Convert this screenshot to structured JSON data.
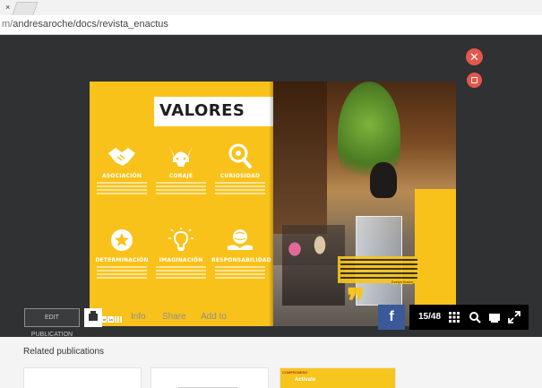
{
  "browser": {
    "tab_close": "×",
    "url_prefix": "m/",
    "url_path": "andresaroche/docs/revista_enactus"
  },
  "publication": {
    "left_page": {
      "title": "VALORES",
      "values": [
        {
          "label": "ASOCIACIÓN",
          "icon": "handshake-icon"
        },
        {
          "label": "CORAJE",
          "icon": "viking-helmet-icon"
        },
        {
          "label": "CURIOSIDAD",
          "icon": "magnifier-icon"
        },
        {
          "label": "DETERMINACIÓN",
          "icon": "star-badge-icon"
        },
        {
          "label": "IMAGINACIÓN",
          "icon": "lightbulb-icon"
        },
        {
          "label": "RESPONSABILIDAD",
          "icon": "hands-globe-icon"
        }
      ],
      "mini_pager": {
        "cell_a": "View Tut",
        "cell_b": "1a"
      }
    },
    "right_page": {
      "quote_mark": "❞",
      "signature": "Evelyn Ibarra"
    }
  },
  "overlay_buttons": {
    "close_symbol": "✕",
    "colors": {
      "accent": "#e2574c"
    }
  },
  "toolbar": {
    "edit_label": "EDIT PUBLICATION",
    "links": [
      "Info",
      "Share",
      "Add to"
    ],
    "fb_label": "f",
    "page_count": "15/48",
    "icons": [
      "grid-icon",
      "search-icon",
      "reading-mode-icon",
      "fullscreen-icon"
    ]
  },
  "related": {
    "title": "Related publications",
    "third_card": {
      "tagline": "COMPROMISO",
      "cta": "Actívate"
    }
  },
  "colors": {
    "brand_yellow": "#f9c21b",
    "viewer_bg": "#2f3133",
    "facebook": "#3b5998"
  }
}
